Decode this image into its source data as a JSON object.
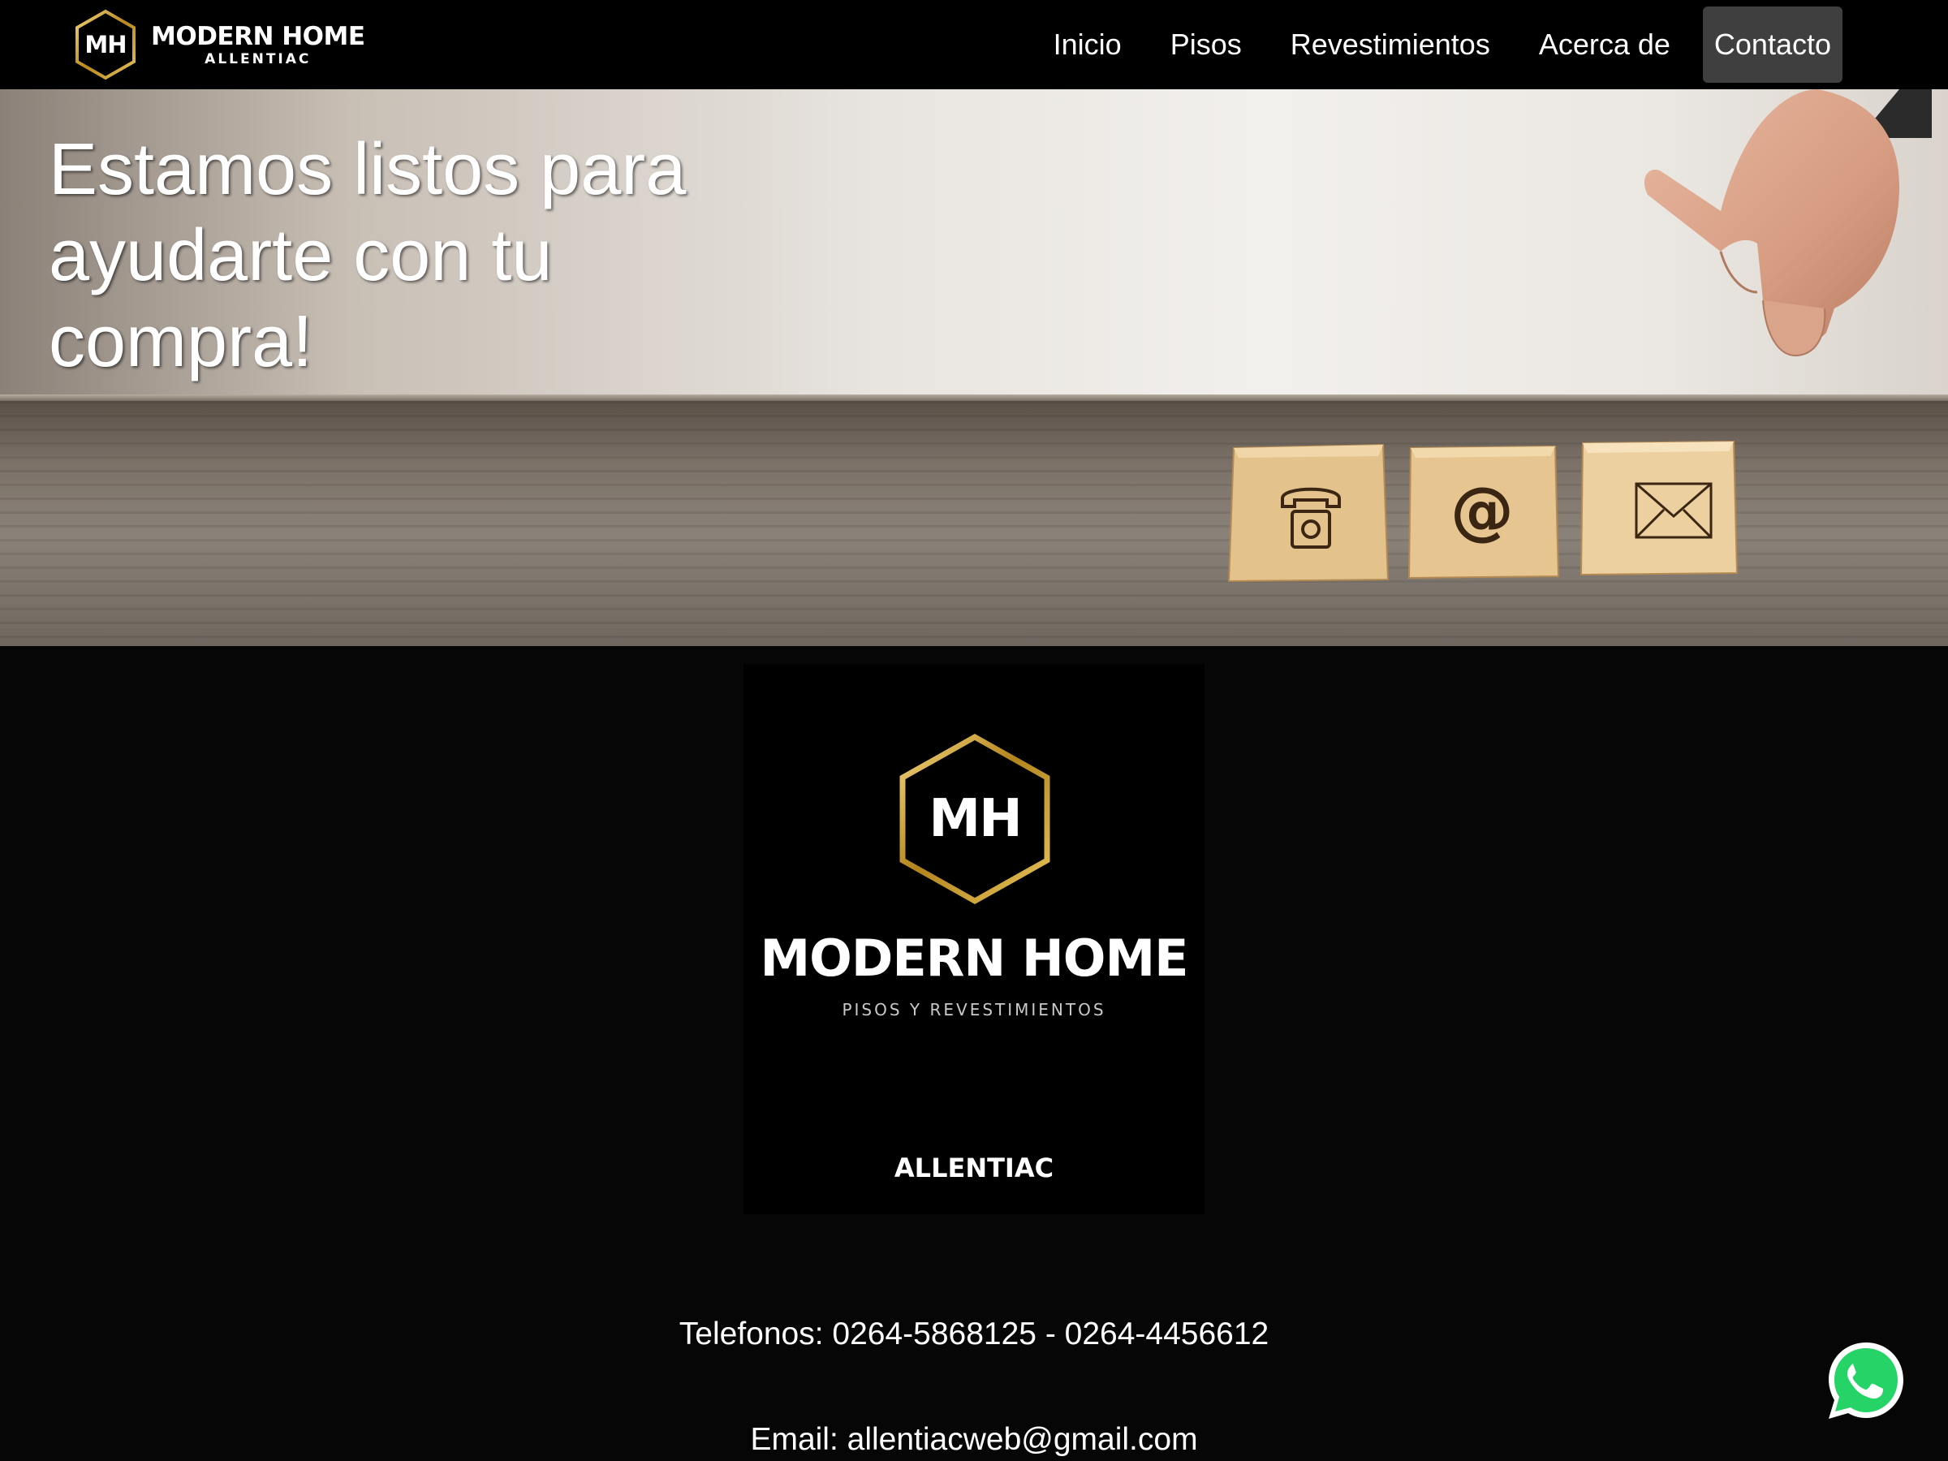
{
  "navbar": {
    "brand_initials": "MH",
    "brand_name": "MODERN HOME",
    "brand_sub": "ALLENTIAC",
    "links": [
      {
        "label": "Inicio"
      },
      {
        "label": "Pisos"
      },
      {
        "label": "Revestimientos"
      },
      {
        "label": "Acerca de"
      },
      {
        "label": "Contacto",
        "active": true
      }
    ]
  },
  "hero": {
    "title": "Estamos listos para ayudarte con tu compra!",
    "blocks": [
      "phone-icon",
      "at-icon",
      "envelope-icon"
    ]
  },
  "logo": {
    "initials": "MH",
    "name": "MODERN HOME",
    "tagline": "PISOS Y REVESTIMIENTOS",
    "sub": "ALLENTIAC"
  },
  "contact": {
    "phones": "Telefonos: 0264-5868125 - 0264-4456612",
    "email": "Email: allentiacweb@gmail.com"
  },
  "whatsapp": {
    "icon": "whatsapp-icon"
  },
  "colors": {
    "navbar_bg": "#000000",
    "active_link_bg": "#3f3f3f",
    "page_bg": "#060606",
    "gold": "#c9a227",
    "whatsapp_green": "#25d366"
  }
}
